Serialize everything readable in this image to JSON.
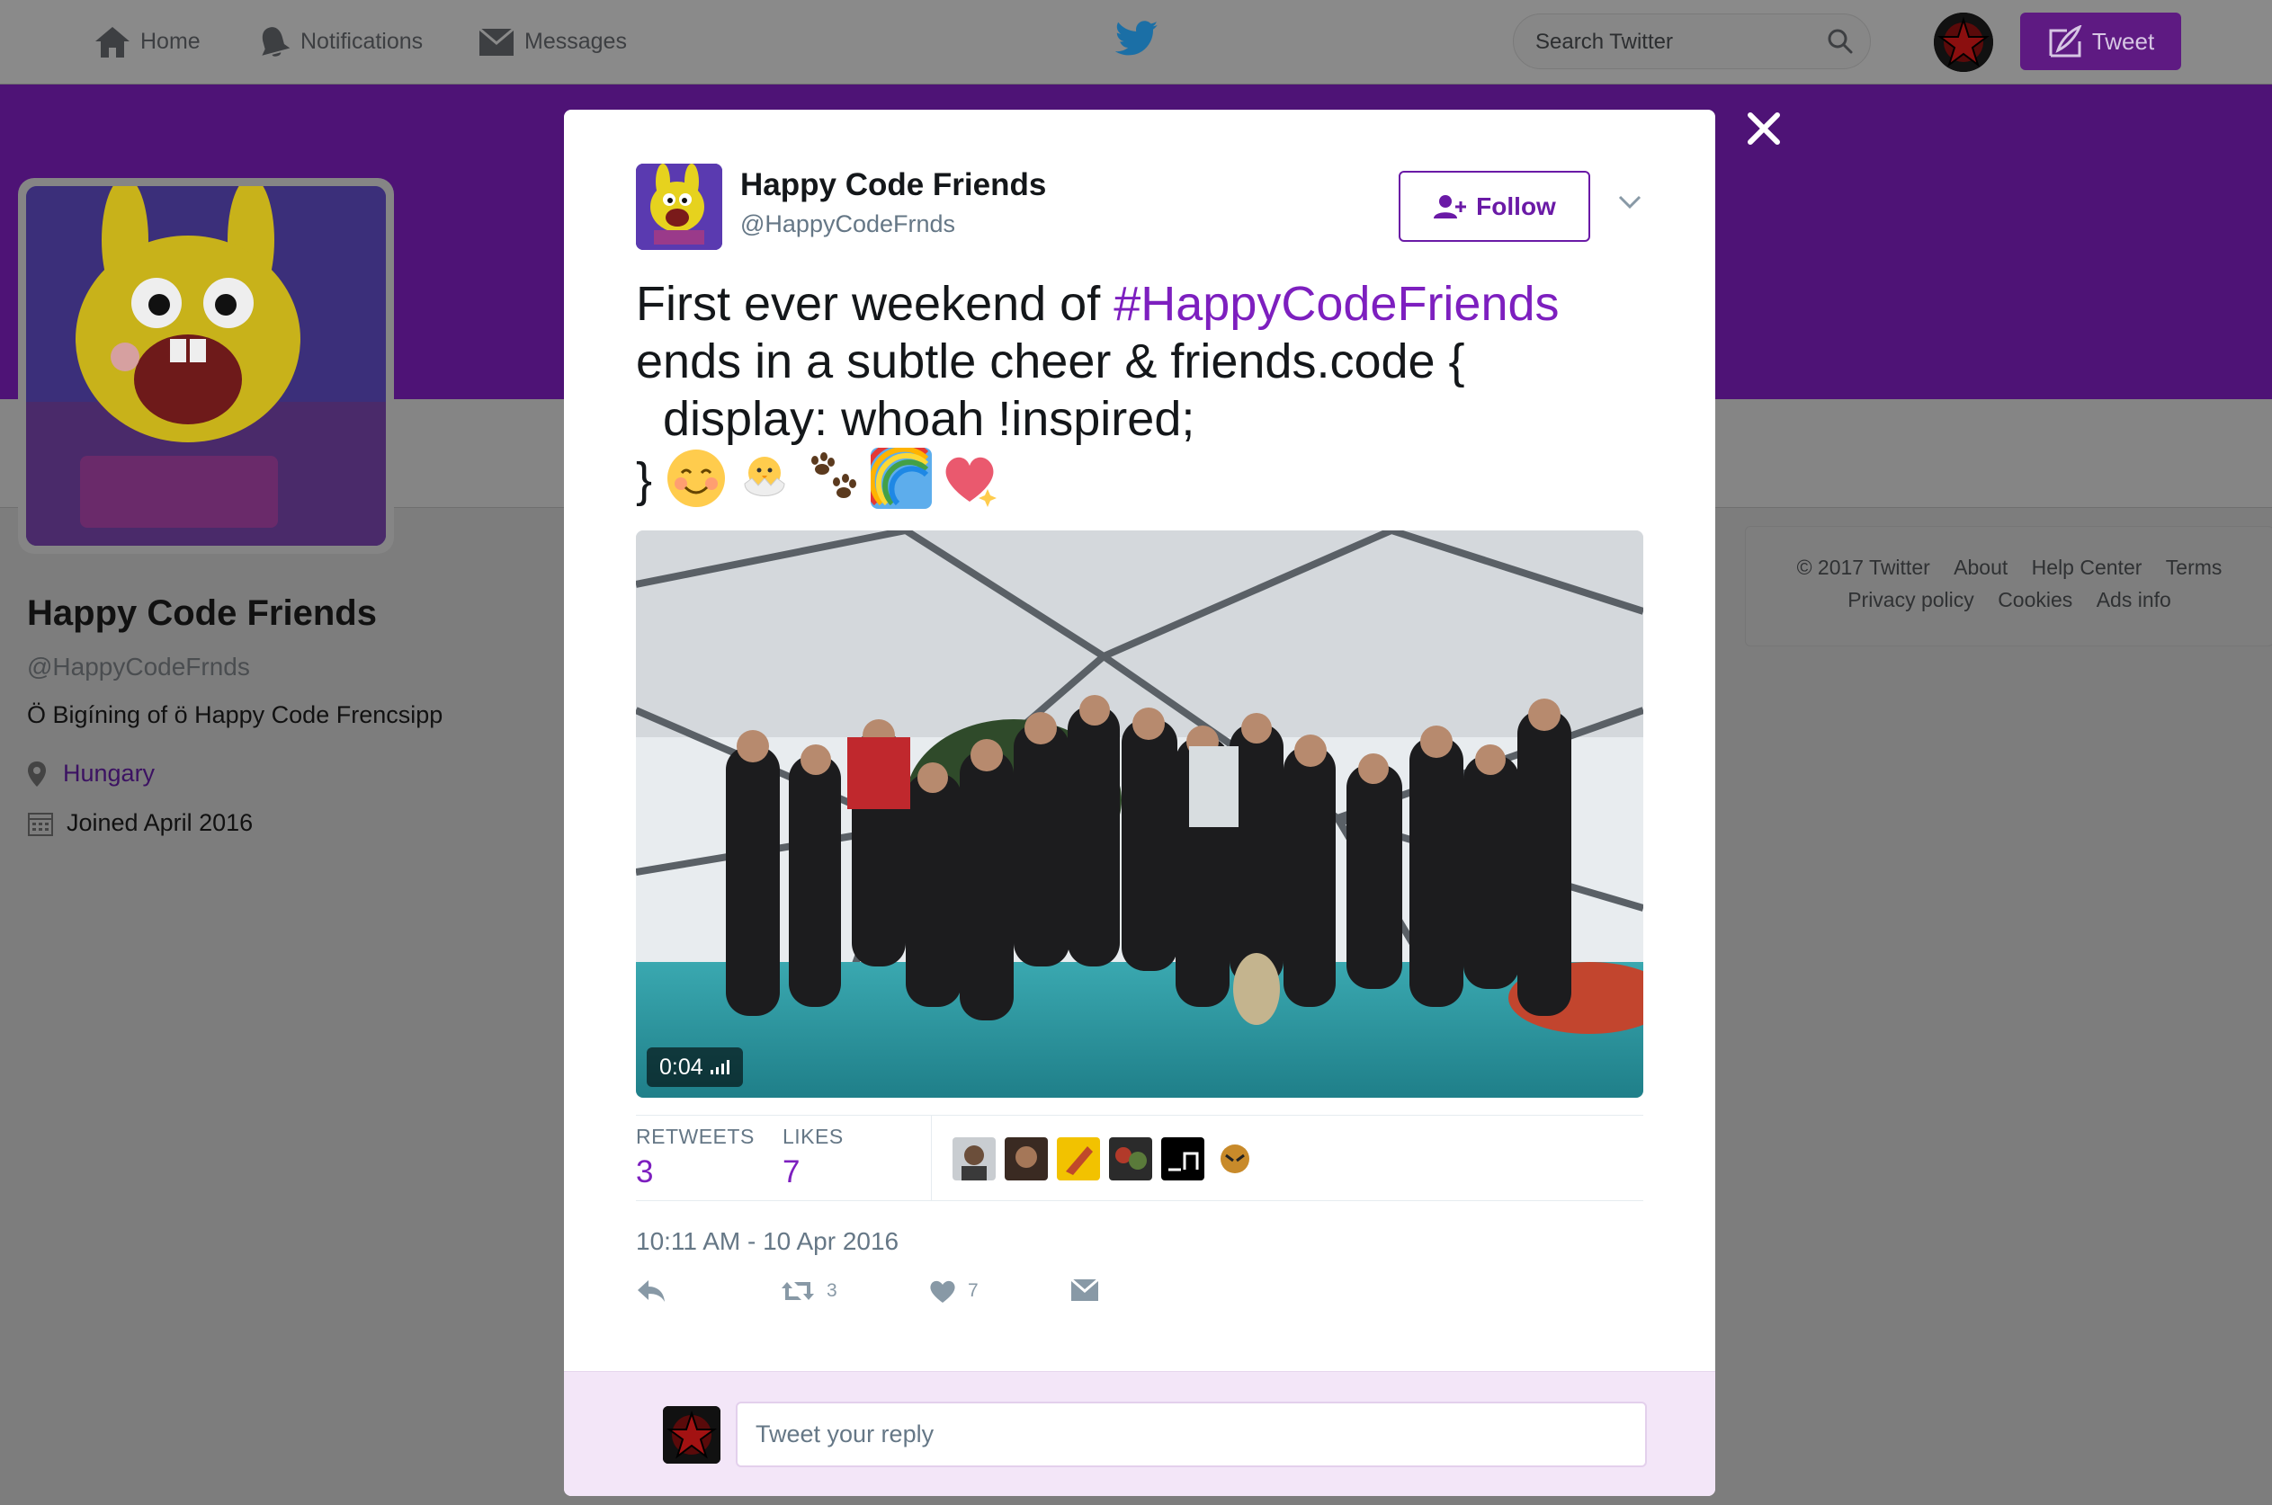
{
  "nav": {
    "home": "Home",
    "notifications": "Notifications",
    "messages": "Messages",
    "search_placeholder": "Search Twitter",
    "tweet_button": "Tweet"
  },
  "profile": {
    "name": "Happy Code Friends",
    "handle": "@HappyCodeFrnds",
    "bio": "Ö Bigíning of ö Happy Code Frencsipp",
    "location": "Hungary",
    "joined": "Joined April 2016"
  },
  "footer": {
    "row1": [
      "© 2017 Twitter",
      "About",
      "Help Center",
      "Terms"
    ],
    "row2": [
      "Privacy policy",
      "Cookies",
      "Ads info"
    ]
  },
  "tweet": {
    "name": "Happy Code Friends",
    "handle": "@HappyCodeFrnds",
    "follow_label": "Follow",
    "text_before": "First ever weekend of ",
    "hashtag": "#HappyCodeFriends",
    "text_after": "\nends in a subtle cheer & friends.code {\n  display: whoah !inspired;\n} ",
    "emojis": [
      "smiling-face-emoji",
      "hatching-chick-emoji",
      "paw-prints-emoji",
      "rainbow-emoji",
      "sparkling-heart-emoji"
    ],
    "video_duration": "0:04",
    "retweets_label": "RETWEETS",
    "retweets_count": "3",
    "likes_label": "LIKES",
    "likes_count": "7",
    "timestamp": "10:11 AM - 10 Apr 2016",
    "action_retweet_count": "3",
    "action_like_count": "7",
    "reply_placeholder": "Tweet your reply"
  },
  "colors": {
    "brand_purple": "#7d1fbf",
    "banner_purple": "#4e1376",
    "twitter_blue": "#1b95e0"
  }
}
